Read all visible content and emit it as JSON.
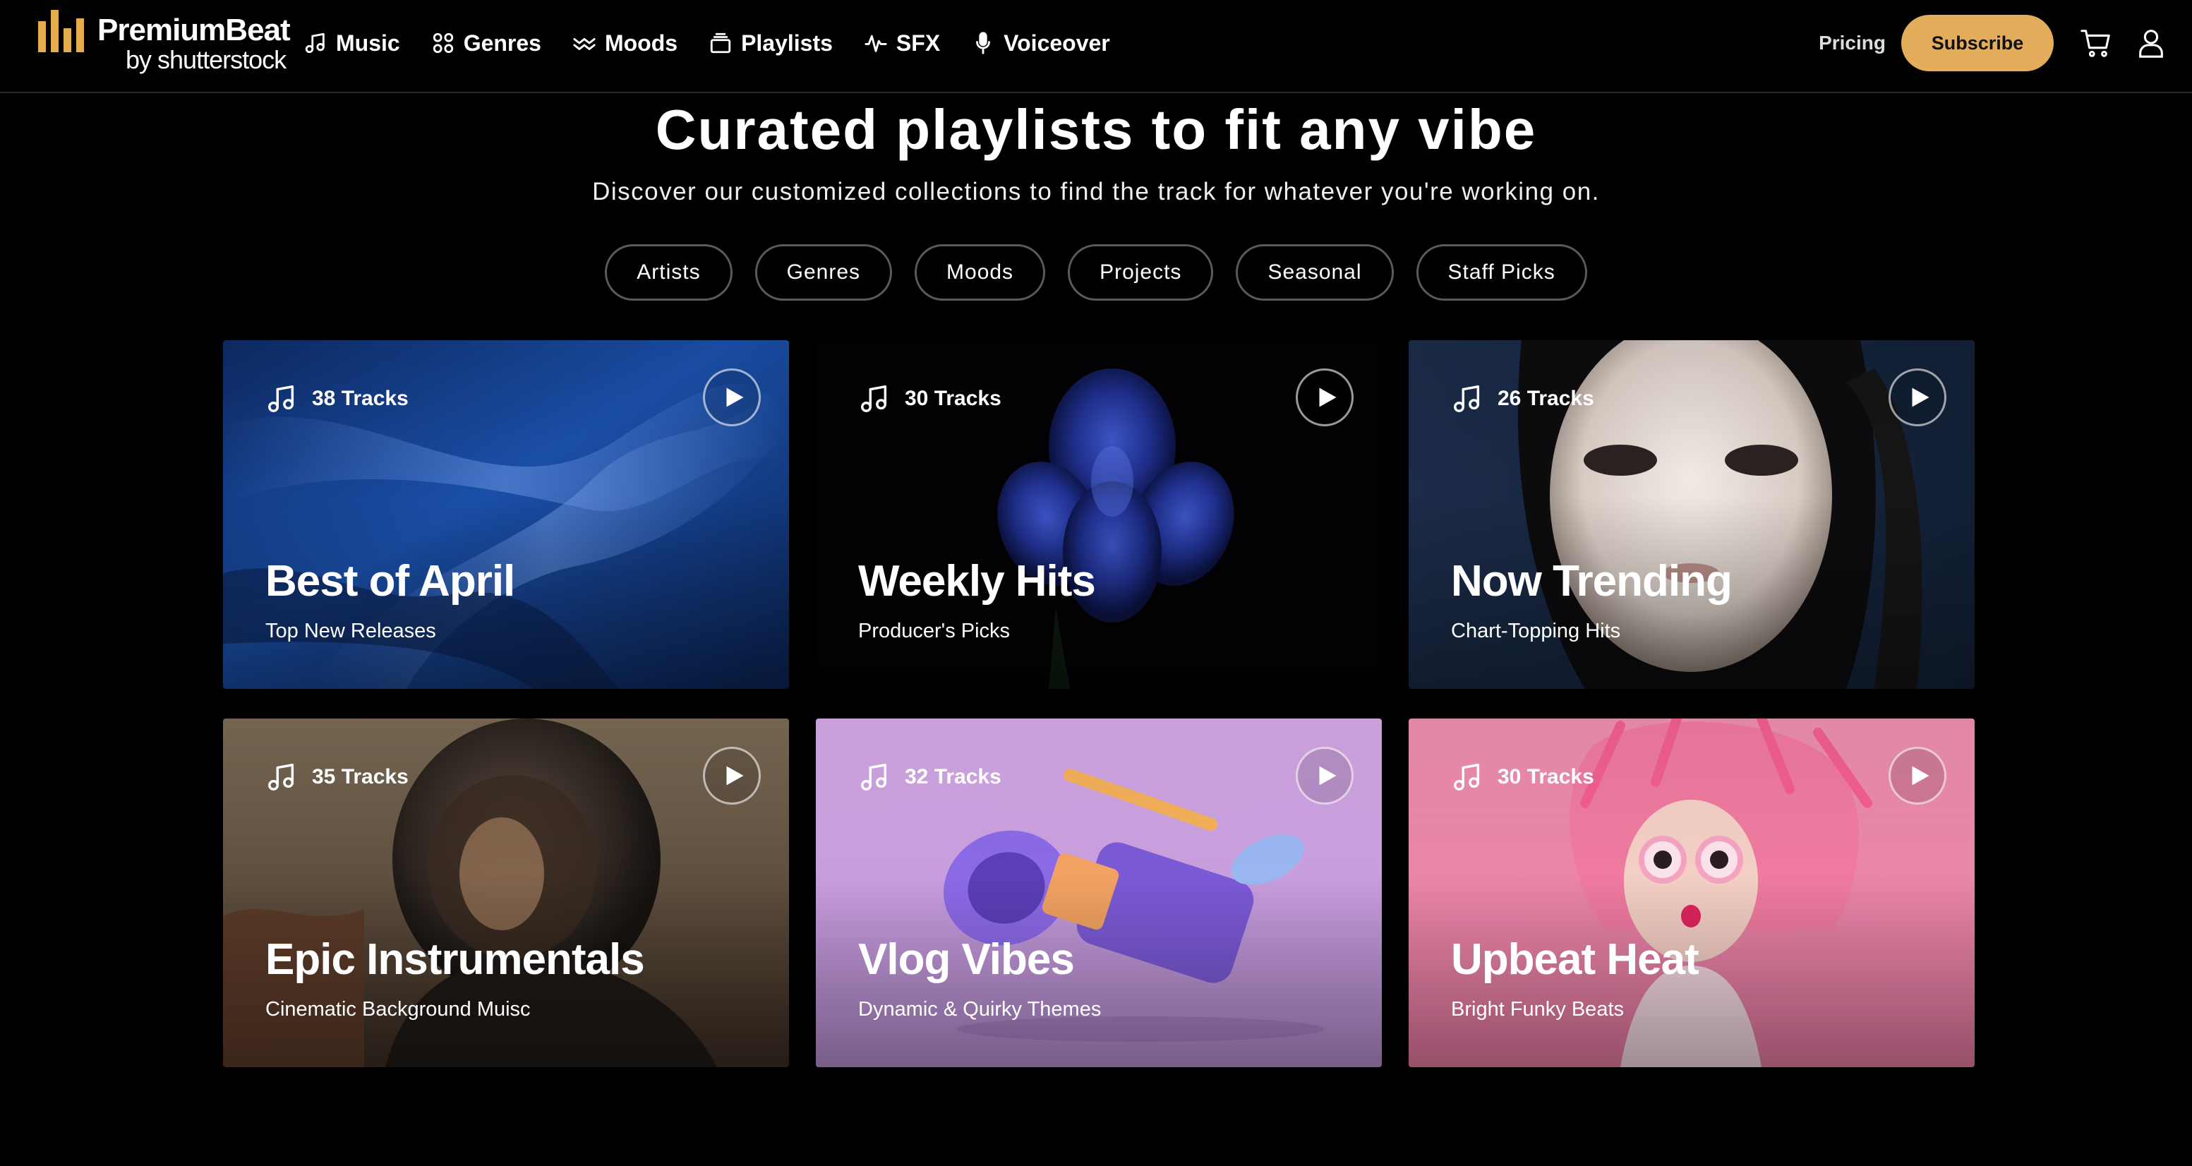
{
  "brand": {
    "name": "PremiumBeat",
    "sub": "by shutterstock",
    "color": "#e3ad4c"
  },
  "nav": {
    "items": [
      {
        "label": "Music",
        "icon": "music-note-icon"
      },
      {
        "label": "Genres",
        "icon": "grid-icon"
      },
      {
        "label": "Moods",
        "icon": "waves-icon"
      },
      {
        "label": "Playlists",
        "icon": "playlist-icon"
      },
      {
        "label": "SFX",
        "icon": "waveform-icon"
      },
      {
        "label": "Voiceover",
        "icon": "microphone-icon"
      }
    ],
    "pricing": "Pricing",
    "subscribe": "Subscribe",
    "subscribe_color": "#e3ad5b"
  },
  "hero": {
    "title": "Curated playlists to fit any vibe",
    "subtitle": "Discover our customized collections to find the track for whatever you're working on."
  },
  "filters": [
    "Artists",
    "Genres",
    "Moods",
    "Projects",
    "Seasonal",
    "Staff Picks"
  ],
  "cards": [
    {
      "tracks": "38 Tracks",
      "title": "Best of April",
      "subtitle": "Top New Releases",
      "art": "blue-silk-fabric"
    },
    {
      "tracks": "30 Tracks",
      "title": "Weekly Hits",
      "subtitle": "Producer's Picks",
      "art": "blue-iris-flower"
    },
    {
      "tracks": "26 Tracks",
      "title": "Now Trending",
      "subtitle": "Chart-Topping Hits",
      "art": "portrait-white-makeup"
    },
    {
      "tracks": "35 Tracks",
      "title": "Epic Instrumentals",
      "subtitle": "Cinematic Background Muisc",
      "art": "astronaut-helmet"
    },
    {
      "tracks": "32 Tracks",
      "title": "Vlog Vibes",
      "subtitle": "Dynamic & Quirky Themes",
      "art": "purple-camcorder"
    },
    {
      "tracks": "30 Tracks",
      "title": "Upbeat Heat",
      "subtitle": "Bright Funky Beats",
      "art": "pink-hair-sunglasses"
    }
  ]
}
